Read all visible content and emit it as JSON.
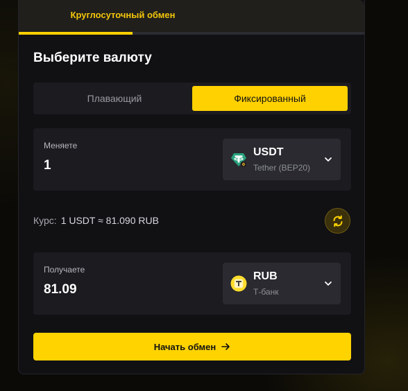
{
  "header": {
    "title": "Круглосуточный обмен"
  },
  "main": {
    "section_title": "Выберите валюту",
    "rate_type": {
      "options": [
        "Плавающий",
        "Фиксированный"
      ],
      "selected": "Фиксированный"
    },
    "send": {
      "label": "Меняете",
      "amount": "1",
      "currency_code": "USDT",
      "currency_network": "Tether (BEP20)",
      "icon": "tether-icon"
    },
    "rate": {
      "label": "Курс:",
      "value": "1 USDT ≈ 81.090 RUB"
    },
    "swap_icon": "swap-arrows-icon",
    "receive": {
      "label": "Получаете",
      "amount": "81.09",
      "currency_code": "RUB",
      "currency_network": "Т-банк",
      "icon": "tbank-icon"
    },
    "submit_label": "Начать обмен",
    "submit_icon": "arrow-right-icon"
  },
  "colors": {
    "accent": "#ffd300",
    "background": "#111114",
    "panel": "#1b1b20",
    "tether_green": "#26a17b"
  }
}
